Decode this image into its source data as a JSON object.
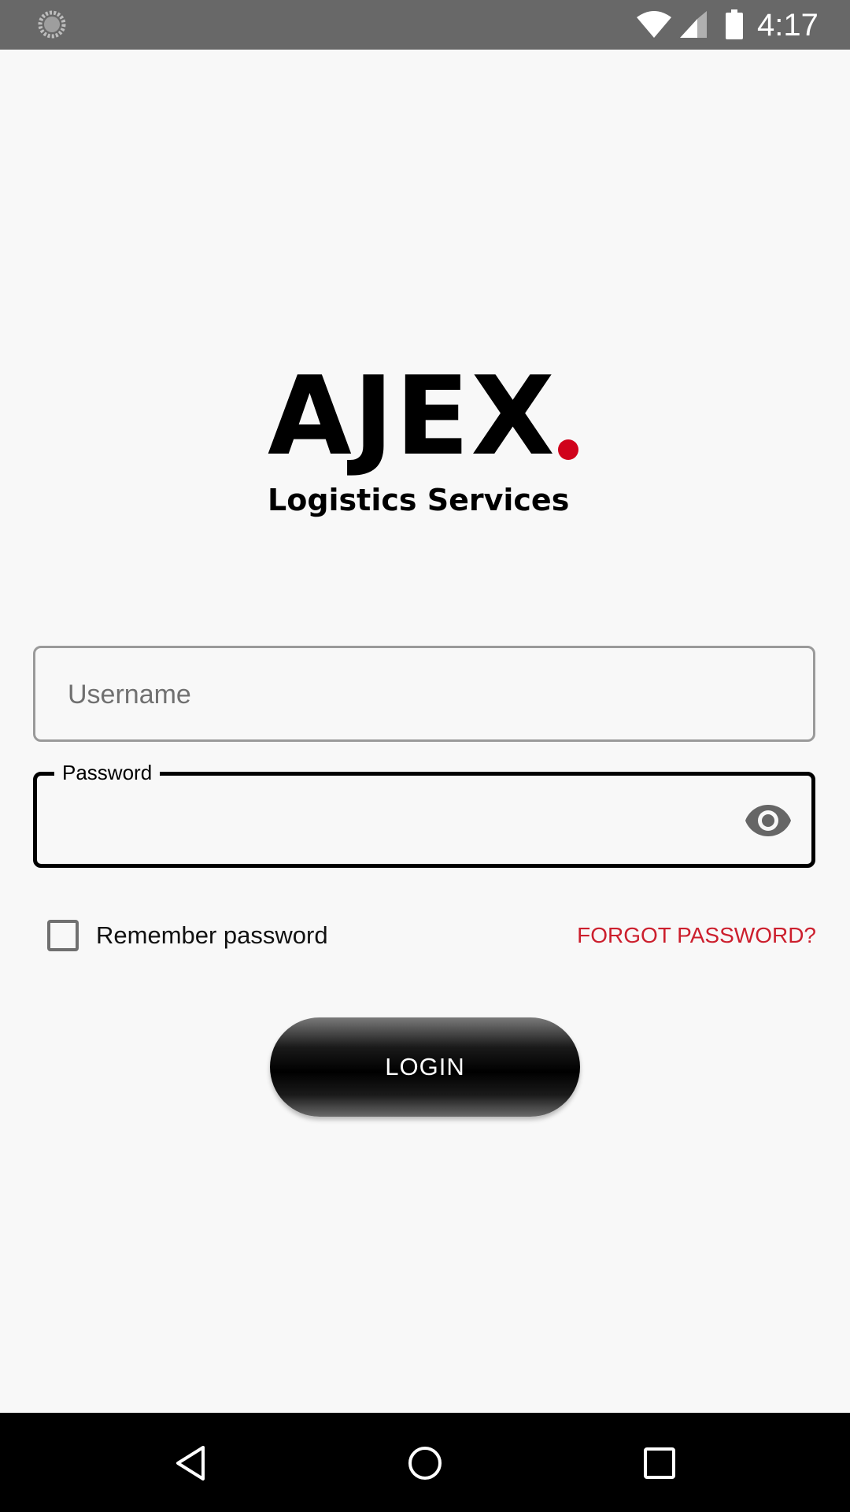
{
  "status_bar": {
    "time": "4:17",
    "icons": [
      "loading-spinner-icon",
      "wifi-icon",
      "signal-icon",
      "battery-icon"
    ]
  },
  "logo": {
    "brand": "AJEX",
    "dot_color": "#d0021b",
    "tagline": "Logistics Services"
  },
  "form": {
    "username": {
      "placeholder": "Username",
      "value": ""
    },
    "password": {
      "label": "Password",
      "value": "",
      "toggle_icon": "eye-icon"
    },
    "remember": {
      "label": "Remember password",
      "checked": false
    },
    "forgot_label": "FORGOT PASSWORD?",
    "login_label": "LOGIN"
  },
  "colors": {
    "accent_red": "#cc1f2d",
    "background": "#f8f8f8",
    "status_bar": "#686868",
    "nav_bar": "#000000"
  },
  "nav_bar": {
    "icons": [
      "back-icon",
      "home-icon",
      "recent-apps-icon"
    ]
  }
}
